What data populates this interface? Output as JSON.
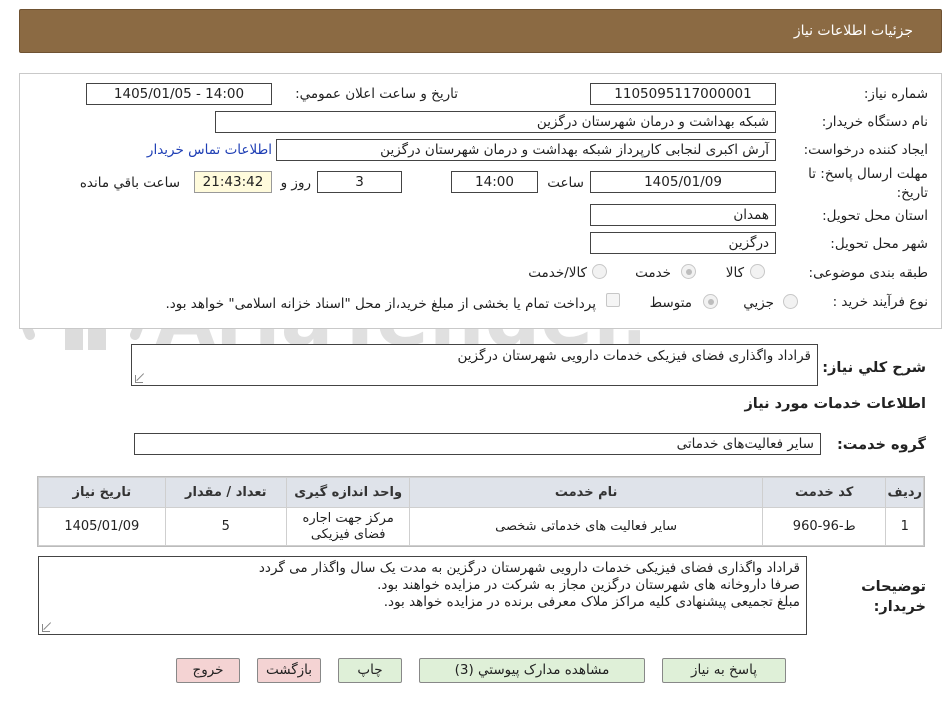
{
  "header": {
    "title": "جزئیات اطلاعات نیاز"
  },
  "form": {
    "need_number": {
      "label": "شماره نیاز:",
      "value": "1105095117000001"
    },
    "announce": {
      "label": "تاریخ و ساعت اعلان عمومي:",
      "value": "1405/01/05 - 14:00"
    },
    "buyer": {
      "label": "نام دستگاه خریدار:",
      "value": "شبکه بهداشت و درمان شهرستان درگزین"
    },
    "requester": {
      "label": "ایجاد کننده درخواست:",
      "value": "آرش اکبری لنجابی کارپرداز شبکه بهداشت و درمان شهرستان درگزین",
      "contact_link": "اطلاعات تماس خریدار"
    },
    "deadline": {
      "label": "مهلت ارسال پاسخ: تا تاریخ:",
      "date": "1405/01/09",
      "time_label": "ساعت",
      "time": "14:00",
      "days": "3",
      "days_label": "روز و",
      "remaining": "21:43:42",
      "remaining_label": "ساعت باقي مانده"
    },
    "province": {
      "label": "استان محل تحویل:",
      "value": "همدان"
    },
    "city": {
      "label": "شهر محل تحویل:",
      "value": "درگزین"
    },
    "category": {
      "label": "طبقه بندی موضوعی:",
      "options": [
        "کالا",
        "خدمت",
        "کالا/خدمت"
      ],
      "selected": "خدمت"
    },
    "process": {
      "label": "نوع فرآیند خرید :",
      "options": [
        "جزيي",
        "متوسط"
      ],
      "selected": "متوسط",
      "payment_note": "پرداخت تمام یا بخشی از مبلغ خرید،از محل \"اسناد خزانه اسلامی\" خواهد بود."
    }
  },
  "summary": {
    "label": "شرح کلي نیاز:",
    "value": "قراداد واگذاری فضای فیزیکی خدمات دارویی شهرستان درگزین"
  },
  "services": {
    "title": "اطلاعات خدمات مورد نیاز",
    "group_label": "گروه خدمت:",
    "group_value": "سایر فعالیت‌های خدماتی",
    "columns": [
      "ردیف",
      "کد خدمت",
      "نام خدمت",
      "واحد اندازه گیری",
      "تعداد / مقدار",
      "تاریخ نیاز"
    ],
    "rows": [
      {
        "row": "1",
        "code": "ط-96-960",
        "name": "سایر فعالیت های خدماتی شخصی",
        "unit": "مرکز جهت اجاره فضای فیزیکی",
        "qty": "5",
        "date": "1405/01/09"
      }
    ]
  },
  "notes": {
    "label": "توضیحات خریدار:",
    "lines": [
      "قراداد واگذاری فضای فیزیکی خدمات دارویی شهرستان درگزین به مدت یک سال واگذار می گردد",
      "صرفا داروخانه های شهرستان درگزین مجاز به شرکت در مزایده خواهند بود.",
      "مبلغ تجمیعی پیشنهادی کلیه مراکز ملاک معرفی برنده در مزایده خواهد بود."
    ]
  },
  "buttons": {
    "reply": "پاسخ به نیاز",
    "attachments": "مشاهده مدارک پیوستي (3)",
    "print": "چاپ",
    "back": "بازگشت",
    "exit": "خروج"
  },
  "watermark": {
    "text": "AriaTender.neT",
    "color": "#d8d8d8"
  }
}
